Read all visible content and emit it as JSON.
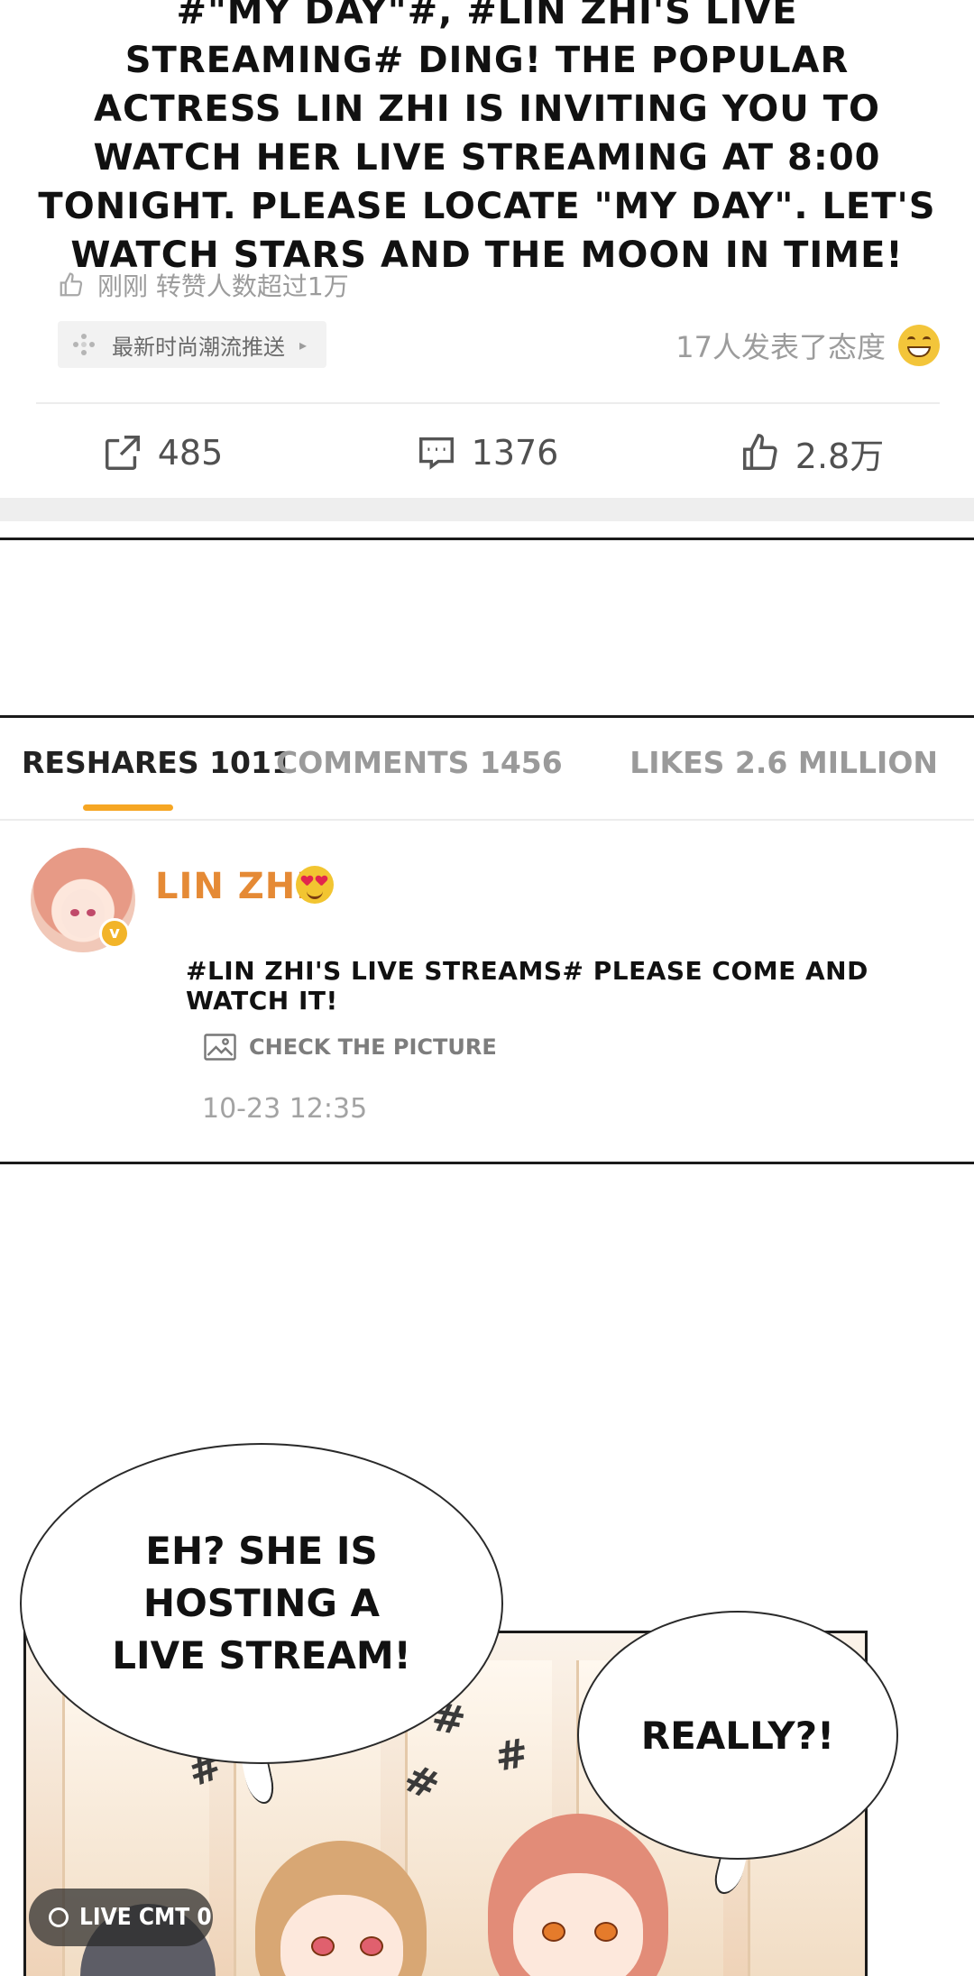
{
  "post": {
    "body": "#\"MY DAY\"#, #LIN ZHI'S LIVE STREAMING# DING! THE POPULAR ACTRESS LIN ZHI IS INVITING YOU TO WATCH HER LIVE STREAMING AT 8:00 TONIGHT. PLEASE LOCATE \"MY DAY\". LET'S WATCH STARS AND THE MOON IN TIME!",
    "meta": "刚刚 转赞人数超过1万",
    "trend_chip": "最新时尚潮流推送",
    "trend_chip_arrow": "▸",
    "attitude": "17人发表了态度",
    "reshares": "485",
    "comments": "1376",
    "likes": "2.8万"
  },
  "stats": {
    "reshares": "RESHARES 1011",
    "comments": "COMMENTS 1456",
    "likes": "LIKES 2.6 MILLION"
  },
  "comment": {
    "user": "LIN ZHI",
    "verified_mark": "v",
    "text": "#LIN ZHI'S LIVE STREAMS# PLEASE COME AND WATCH IT!",
    "check_picture": "CHECK THE PICTURE",
    "time": "10-23 12:35"
  },
  "scene": {
    "bubble_1": "EH? SHE IS HOSTING A LIVE STREAM!",
    "bubble_2": "REALLY?!",
    "scribble": "#"
  },
  "live": {
    "label": "LIVE CMT 0"
  },
  "colors": {
    "accent": "#f6a623",
    "username": "#e58a35"
  }
}
